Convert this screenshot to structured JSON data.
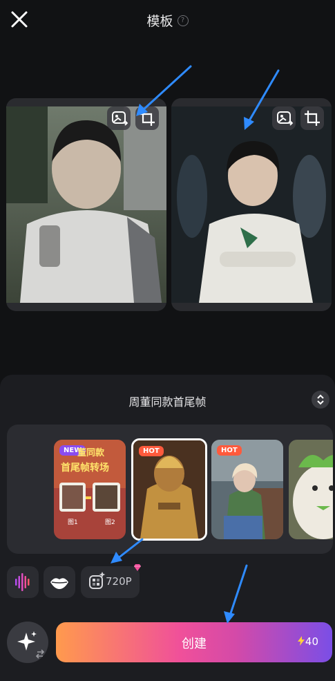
{
  "header": {
    "title": "模板",
    "help_glyph": "?"
  },
  "template": {
    "name": "周董同款首尾帧"
  },
  "thumbnails": [
    {
      "badge": "NEW",
      "caption_line1": "董同款",
      "caption_line2": "首尾帧转场",
      "label_a": "图1",
      "label_b": "图2"
    },
    {
      "badge": "HOT"
    },
    {
      "badge": "HOT"
    },
    {
      "badge": ""
    }
  ],
  "options": {
    "resolution": "720P"
  },
  "create": {
    "label": "创建",
    "credits": "40"
  },
  "colors": {
    "bg": "#111214",
    "panel": "#1c1d21",
    "accent_new": "#8a4cf0",
    "accent_hot": "#ff5a3c",
    "arrow": "#2f8bff"
  }
}
